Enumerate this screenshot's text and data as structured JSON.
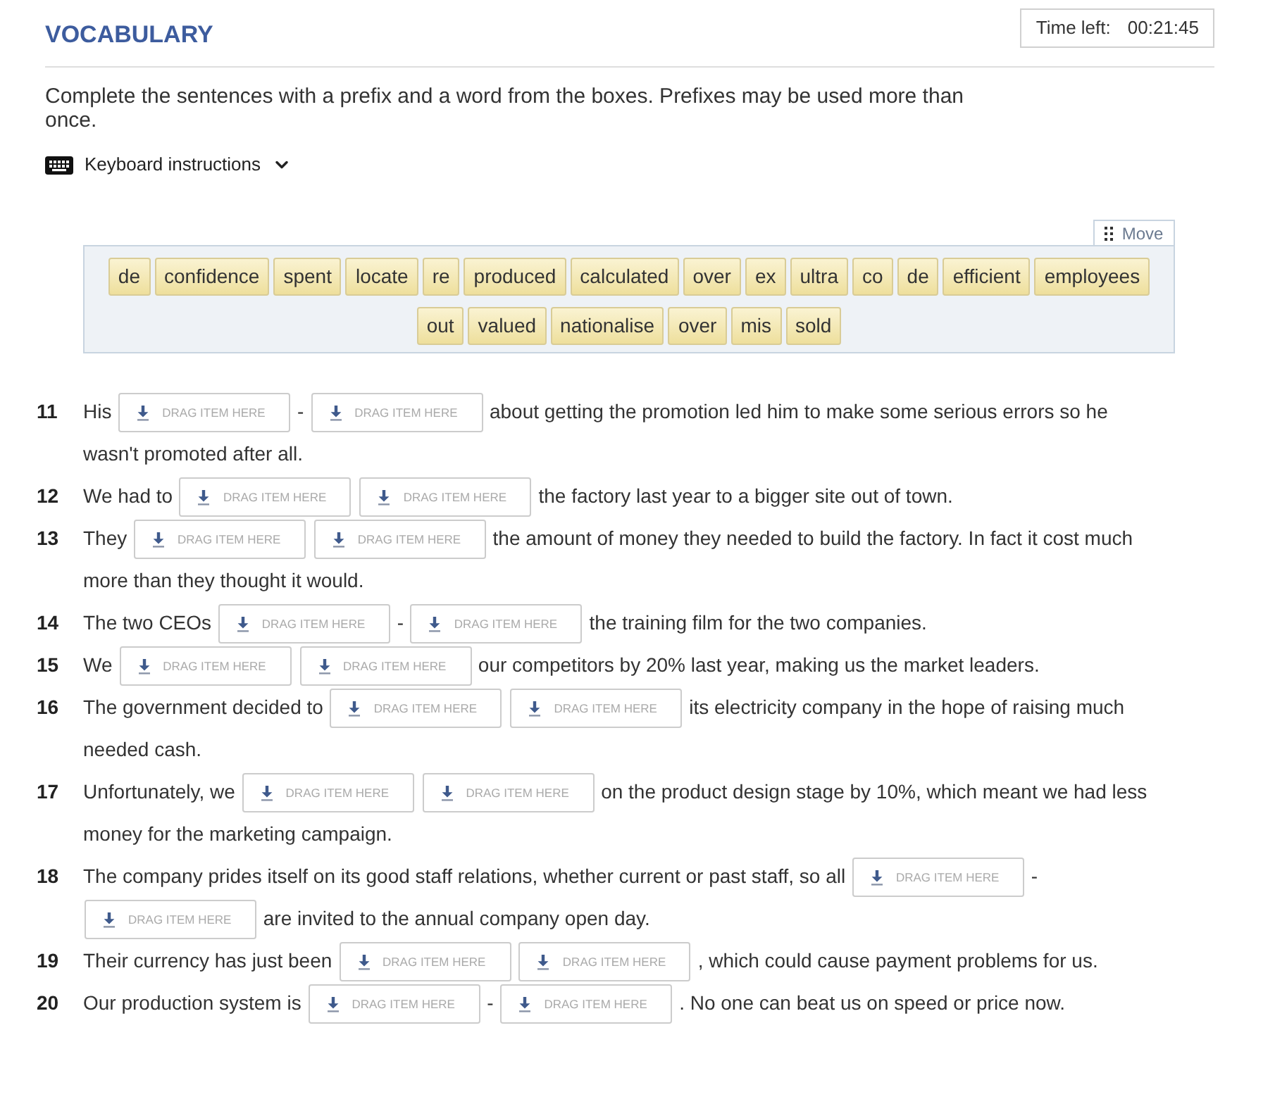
{
  "header": {
    "title": "VOCABULARY",
    "timer": {
      "label": "Time left:",
      "value": "00:21:45"
    }
  },
  "instructions": "Complete the sentences with a prefix and a word from the boxes. Prefixes may be used more than once.",
  "keyboard_instructions": {
    "label": "Keyboard instructions",
    "expanded": false
  },
  "word_bank": {
    "move_label": "Move",
    "words": [
      "de",
      "confidence",
      "spent",
      "locate",
      "re",
      "produced",
      "calculated",
      "over",
      "ex",
      "ultra",
      "co",
      "de",
      "efficient",
      "employees",
      "out",
      "valued",
      "nationalise",
      "over",
      "mis",
      "sold"
    ]
  },
  "sentences": [
    {
      "number": "11",
      "lines": [
        [
          {
            "kind": "text",
            "text": "His"
          },
          {
            "kind": "drop",
            "placeholder": "DRAG ITEM HERE"
          },
          {
            "kind": "text",
            "text": "-"
          },
          {
            "kind": "drop",
            "placeholder": "DRAG ITEM HERE"
          },
          {
            "kind": "text",
            "text": "about getting the promotion led him to make some serious errors so he"
          }
        ],
        [
          {
            "kind": "text",
            "text": "wasn't promoted after all."
          }
        ]
      ]
    },
    {
      "number": "12",
      "lines": [
        [
          {
            "kind": "text",
            "text": "We had to"
          },
          {
            "kind": "drop",
            "placeholder": "DRAG ITEM HERE"
          },
          {
            "kind": "drop",
            "placeholder": "DRAG ITEM HERE"
          },
          {
            "kind": "text",
            "text": "the factory last year to a bigger site out of town."
          }
        ]
      ]
    },
    {
      "number": "13",
      "lines": [
        [
          {
            "kind": "text",
            "text": "They"
          },
          {
            "kind": "drop",
            "placeholder": "DRAG ITEM HERE"
          },
          {
            "kind": "drop",
            "placeholder": "DRAG ITEM HERE"
          },
          {
            "kind": "text",
            "text": "the amount of money they needed to build the factory. In fact it cost much"
          }
        ],
        [
          {
            "kind": "text",
            "text": "more than they thought it would."
          }
        ]
      ]
    },
    {
      "number": "14",
      "lines": [
        [
          {
            "kind": "text",
            "text": "The two CEOs"
          },
          {
            "kind": "drop",
            "placeholder": "DRAG ITEM HERE"
          },
          {
            "kind": "text",
            "text": "-"
          },
          {
            "kind": "drop",
            "placeholder": "DRAG ITEM HERE"
          },
          {
            "kind": "text",
            "text": "the training film for the two companies."
          }
        ]
      ]
    },
    {
      "number": "15",
      "lines": [
        [
          {
            "kind": "text",
            "text": "We"
          },
          {
            "kind": "drop",
            "placeholder": "DRAG ITEM HERE"
          },
          {
            "kind": "drop",
            "placeholder": "DRAG ITEM HERE"
          },
          {
            "kind": "text",
            "text": "our competitors by 20% last year, making us the market leaders."
          }
        ]
      ]
    },
    {
      "number": "16",
      "lines": [
        [
          {
            "kind": "text",
            "text": "The government decided to"
          },
          {
            "kind": "drop",
            "placeholder": "DRAG ITEM HERE"
          },
          {
            "kind": "drop",
            "placeholder": "DRAG ITEM HERE"
          },
          {
            "kind": "text",
            "text": "its electricity company in the hope of raising much"
          }
        ],
        [
          {
            "kind": "text",
            "text": "needed cash."
          }
        ]
      ]
    },
    {
      "number": "17",
      "lines": [
        [
          {
            "kind": "text",
            "text": "Unfortunately, we"
          },
          {
            "kind": "drop",
            "placeholder": "DRAG ITEM HERE"
          },
          {
            "kind": "drop",
            "placeholder": "DRAG ITEM HERE"
          },
          {
            "kind": "text",
            "text": "on the product design stage by 10%, which meant we had less"
          }
        ],
        [
          {
            "kind": "text",
            "text": "money for the marketing campaign."
          }
        ]
      ]
    },
    {
      "number": "18",
      "lines": [
        [
          {
            "kind": "text",
            "text": "The company prides itself on its good staff relations, whether current or past staff, so all"
          },
          {
            "kind": "drop",
            "placeholder": "DRAG ITEM HERE"
          },
          {
            "kind": "text",
            "text": "-"
          }
        ],
        [
          {
            "kind": "drop",
            "placeholder": "DRAG ITEM HERE"
          },
          {
            "kind": "text",
            "text": "are invited to the annual company open day."
          }
        ]
      ]
    },
    {
      "number": "19",
      "lines": [
        [
          {
            "kind": "text",
            "text": "Their currency has just been"
          },
          {
            "kind": "drop",
            "placeholder": "DRAG ITEM HERE"
          },
          {
            "kind": "drop",
            "placeholder": "DRAG ITEM HERE"
          },
          {
            "kind": "text",
            "text": ", which could cause payment problems for us."
          }
        ]
      ]
    },
    {
      "number": "20",
      "lines": [
        [
          {
            "kind": "text",
            "text": "Our production system is"
          },
          {
            "kind": "drop",
            "placeholder": "DRAG ITEM HERE"
          },
          {
            "kind": "text",
            "text": "-"
          },
          {
            "kind": "drop",
            "placeholder": "DRAG ITEM HERE"
          },
          {
            "kind": "text",
            "text": ". No one can beat us on speed or price now."
          }
        ]
      ]
    }
  ]
}
